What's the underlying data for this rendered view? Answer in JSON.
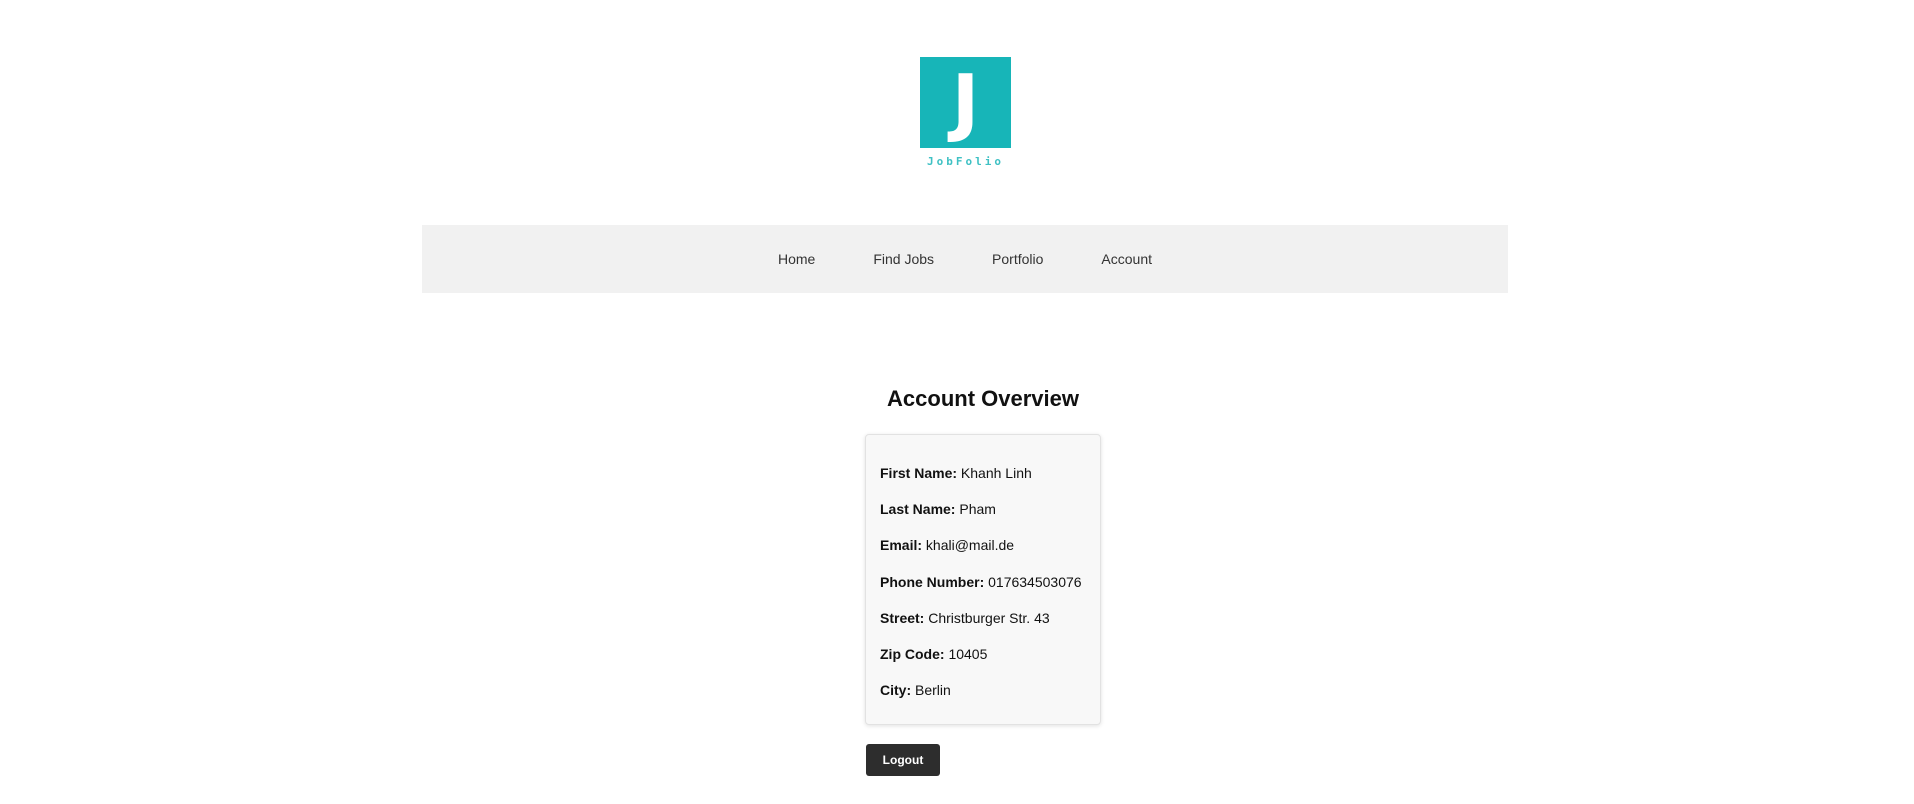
{
  "logo": {
    "letter": "J",
    "text": "JobFolio",
    "color": "#17b5b8"
  },
  "nav": {
    "items": [
      {
        "label": "Home"
      },
      {
        "label": "Find Jobs"
      },
      {
        "label": "Portfolio"
      },
      {
        "label": "Account"
      }
    ]
  },
  "account": {
    "title": "Account Overview",
    "fields": [
      {
        "label": "First Name:",
        "value": "Khanh Linh"
      },
      {
        "label": "Last Name:",
        "value": "Pham"
      },
      {
        "label": "Email:",
        "value": "khali@mail.de"
      },
      {
        "label": "Phone Number:",
        "value": "017634503076"
      },
      {
        "label": "Street:",
        "value": "Christburger Str. 43"
      },
      {
        "label": "Zip Code:",
        "value": "10405"
      },
      {
        "label": "City:",
        "value": "Berlin"
      }
    ],
    "logout_label": "Logout"
  }
}
